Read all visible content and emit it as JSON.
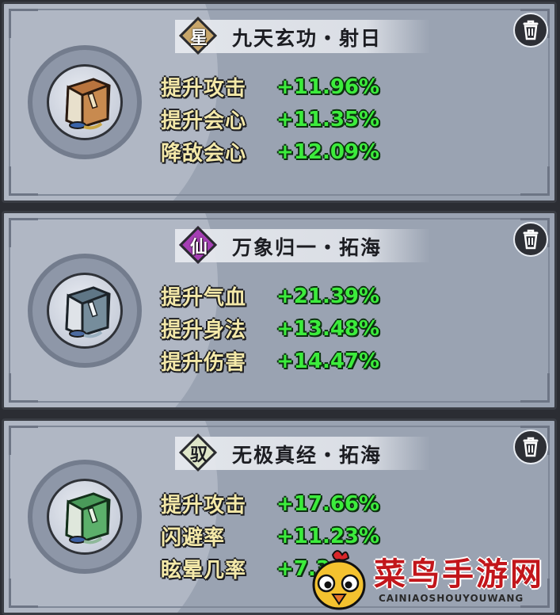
{
  "cards": [
    {
      "rank": "星",
      "rank_color": "#c8a66a",
      "title": "九天玄功・射日",
      "book_color": "#b8743e",
      "stats": [
        {
          "name": "提升攻击",
          "value": "+11.96%"
        },
        {
          "name": "提升会心",
          "value": "+11.35%"
        },
        {
          "name": "降敌会心",
          "value": "+12.09%"
        }
      ]
    },
    {
      "rank": "仙",
      "rank_color": "#a53fb4",
      "title": "万象归一・拓海",
      "book_color": "#5f7686",
      "stats": [
        {
          "name": "提升气血",
          "value": "+21.39%"
        },
        {
          "name": "提升身法",
          "value": "+13.48%"
        },
        {
          "name": "提升伤害",
          "value": "+14.47%"
        }
      ]
    },
    {
      "rank": "驭",
      "rank_color": "#dfe6c9",
      "title": "无极真经・拓海",
      "book_color": "#4a9a5a",
      "stats": [
        {
          "name": "提升攻击",
          "value": "+17.66%"
        },
        {
          "name": "闪避率",
          "value": "+11.23%"
        },
        {
          "name": "眩晕几率",
          "value": "+7.3"
        }
      ]
    }
  ],
  "watermark": {
    "brand": "菜鸟手游网",
    "url": "CAINIAOSHOUYOUWANG"
  },
  "icons": {
    "delete": "trash-icon",
    "book": "book-icon"
  }
}
